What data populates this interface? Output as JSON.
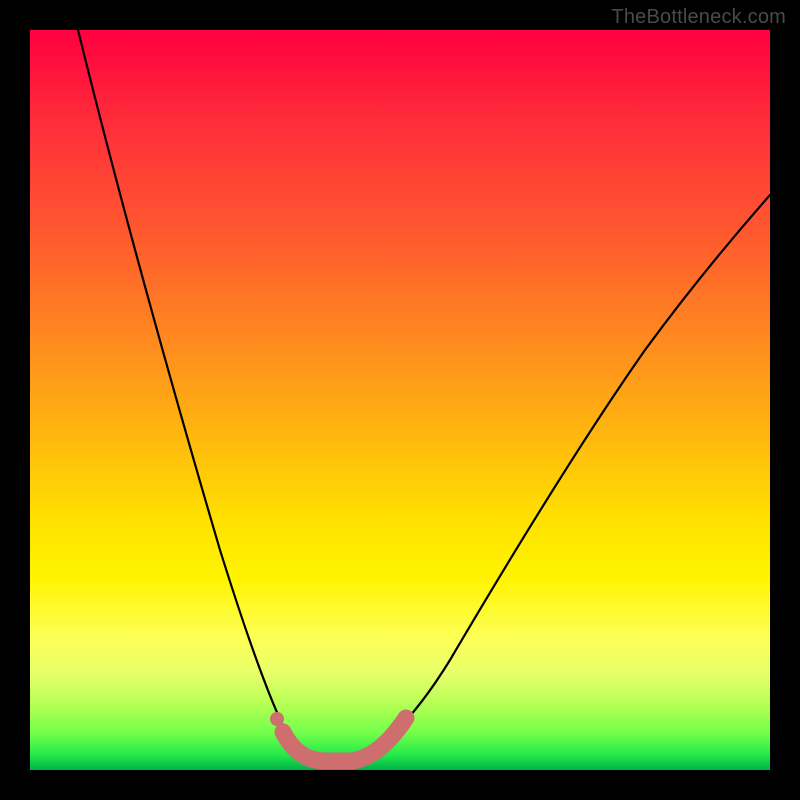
{
  "watermark": {
    "text": "TheBottleneck.com"
  },
  "chart_data": {
    "type": "line",
    "title": "",
    "xlabel": "",
    "ylabel": "",
    "xlim": [
      0,
      100
    ],
    "ylim": [
      0,
      100
    ],
    "grid": false,
    "legend": false,
    "series": [
      {
        "name": "bottleneck-curve",
        "x": [
          5,
          10,
          15,
          20,
          25,
          28,
          30,
          32,
          34,
          36,
          38,
          42,
          46,
          50,
          55,
          62,
          70,
          80,
          90,
          100
        ],
        "values": [
          100,
          80,
          61,
          43,
          26,
          16,
          10,
          5,
          2,
          1,
          1,
          2,
          6,
          12,
          20,
          31,
          43,
          55,
          64,
          72
        ]
      }
    ],
    "highlight": {
      "name": "optimal-range",
      "x": [
        30,
        31,
        32,
        33,
        34,
        35,
        36,
        37,
        38,
        39,
        40,
        41,
        42
      ],
      "values": [
        10,
        7,
        5,
        3,
        2,
        1,
        1,
        1,
        1,
        2,
        2,
        3,
        4
      ],
      "color": "#d16a6a"
    },
    "background_gradient": {
      "top": "#ff0040",
      "mid": "#ffe000",
      "bottom": "#00b24a"
    }
  }
}
